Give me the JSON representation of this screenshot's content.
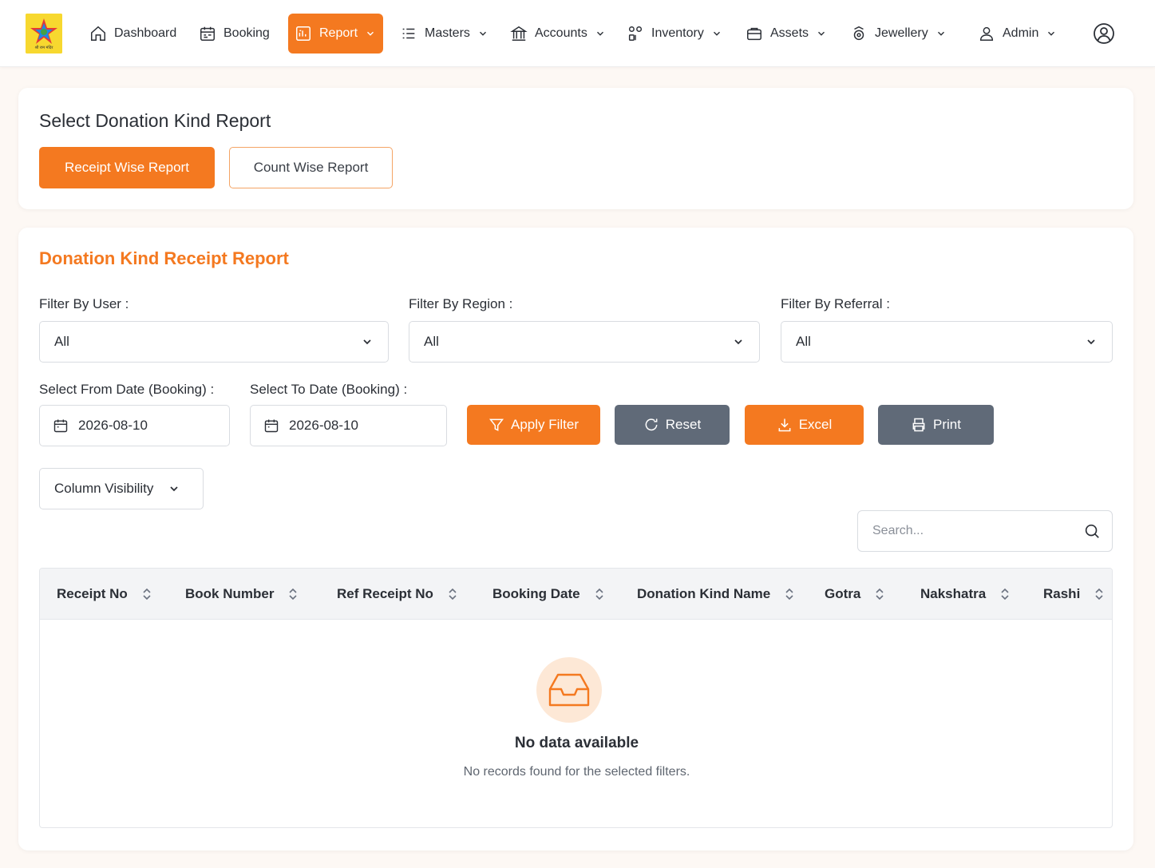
{
  "colors": {
    "accent": "#f47920",
    "gray_button": "#606a78",
    "background": "#fdf8f4"
  },
  "nav": {
    "logo_text": "श्री राम मंदिर",
    "items": [
      {
        "label": "Dashboard",
        "icon": "home-icon"
      },
      {
        "label": "Booking",
        "icon": "calendar-icon"
      },
      {
        "label": "Report",
        "icon": "report-icon",
        "active": true,
        "dropdown": true
      },
      {
        "label": "Masters",
        "icon": "list-icon",
        "dropdown": true
      },
      {
        "label": "Accounts",
        "icon": "bank-icon",
        "dropdown": true
      },
      {
        "label": "Inventory",
        "icon": "boxes-icon",
        "dropdown": true
      },
      {
        "label": "Assets",
        "icon": "briefcase-icon",
        "dropdown": true
      },
      {
        "label": "Jewellery",
        "icon": "ring-icon",
        "dropdown": true
      },
      {
        "label": "Admin",
        "icon": "user-icon",
        "dropdown": true
      }
    ],
    "profile_icon": "user-circle-icon"
  },
  "report_selector": {
    "title": "Select Donation Kind Report",
    "receipt_wise": "Receipt Wise Report",
    "count_wise": "Count Wise Report"
  },
  "report": {
    "title": "Donation Kind Receipt Report",
    "filter_user": {
      "label": "Filter By User :",
      "value": "All"
    },
    "filter_region": {
      "label": "Filter By Region :",
      "value": "All"
    },
    "filter_referral": {
      "label": "Filter By Referral :",
      "value": "All"
    },
    "from_date": {
      "label": "Select From Date (Booking) :",
      "value": "2026-08-10"
    },
    "to_date": {
      "label": "Select To Date (Booking) :",
      "value": "2026-08-10"
    },
    "buttons": {
      "apply": "Apply Filter",
      "reset": "Reset",
      "excel": "Excel",
      "print": "Print"
    },
    "column_visibility": "Column Visibility",
    "search_placeholder": "Search...",
    "columns": [
      "Receipt No",
      "Book Number",
      "Ref Receipt No",
      "Booking Date",
      "Donation Kind Name",
      "Gotra",
      "Nakshatra",
      "Rashi"
    ],
    "empty_title": "No data available",
    "empty_subtitle": "No records found for the selected filters."
  }
}
